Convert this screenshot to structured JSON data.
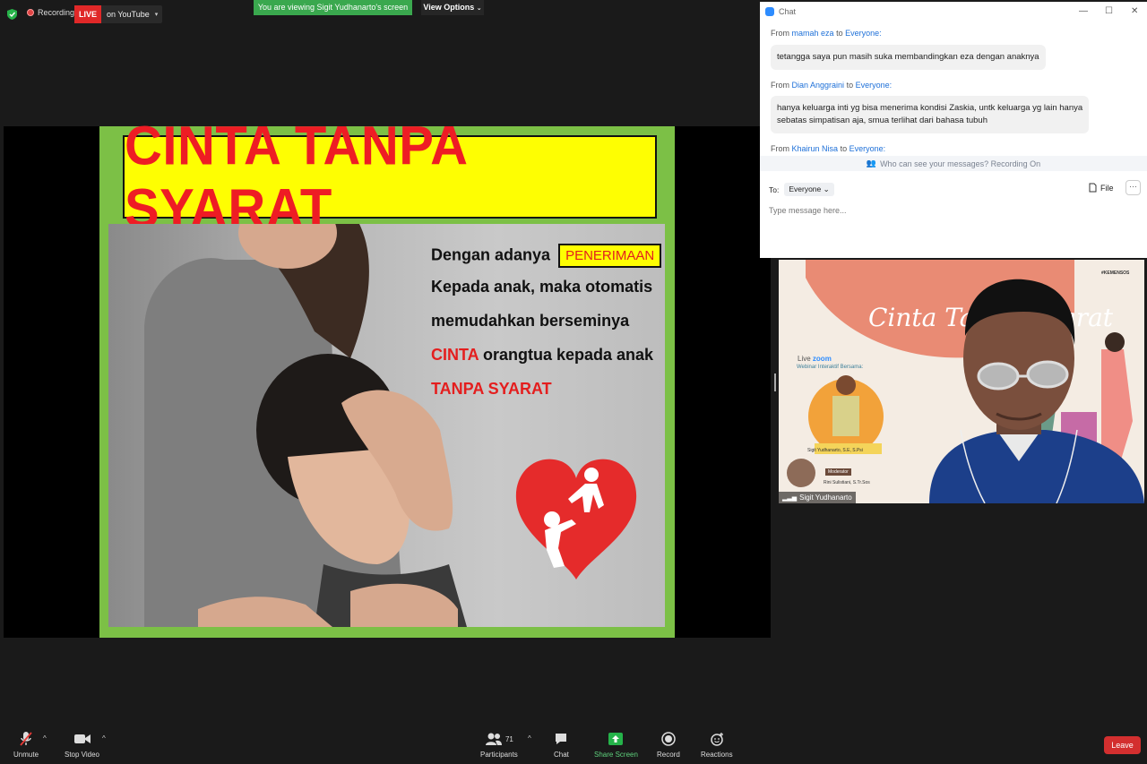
{
  "topbar": {
    "recording_label": "Recording",
    "live_badge": "LIVE",
    "live_destination": "on YouTube",
    "viewing_banner": "You are viewing Sigit Yudhanarto's screen",
    "view_options": "View Options"
  },
  "slide": {
    "title": "CINTA TANPA SYARAT",
    "line1_prefix": "Dengan adanya",
    "line1_box": "PENERIMAAN",
    "line2": "Kepada anak, maka otomatis",
    "line3": "memudahkan berseminya",
    "line4_red": "CINTA",
    "line4_rest": " orangtua kepada anak",
    "line5_red": "TANPA SYARAT",
    "colors": {
      "background": "#7cc046",
      "title_box": "#fefe02",
      "title_text": "#ee1c24",
      "accent_red": "#e41e1e"
    }
  },
  "chat": {
    "title": "Chat",
    "messages": [
      {
        "from_label": "From",
        "sender": "mamah eza",
        "to_label": "to",
        "recipient": "Everyone:",
        "text": "tetangga saya pun masih suka membandingkan eza dengan anaknya"
      },
      {
        "from_label": "From",
        "sender": "Dian Anggraini",
        "to_label": "to",
        "recipient": "Everyone:",
        "text_line1": "hanya keluarga inti yg bisa menerima kondisi Zaskia, untk keluarga yg lain hanya",
        "text_line2": "sebatas simpatisan aja, smua terlihat dari bahasa tubuh"
      },
      {
        "from_label": "From",
        "sender": "Khairun Nisa",
        "to_label": "to",
        "recipient": "Everyone:"
      }
    ],
    "who_can_see": "Who can see your messages? Recording On",
    "to_label": "To:",
    "to_value": "Everyone",
    "file_label": "File",
    "more_label": "···",
    "input_placeholder": "Type message here..."
  },
  "video": {
    "participant_name": "Sigit Yudhanarto",
    "poster_title": "Cinta Tanpa Syarat",
    "poster_live": "Live",
    "poster_zoom": "zoom",
    "poster_webinar": "Webinar Interaktif Bersama:",
    "poster_speaker": "Sigit Yudhanarto, S.E, S.Psi",
    "poster_moderator_label": "Moderator",
    "poster_moderator": "Rini Sulistiani, S.Tr.Sos",
    "poster_brand": "#KEMENSOS"
  },
  "toolbar": {
    "unmute": "Unmute",
    "stop_video": "Stop Video",
    "participants": "Participants",
    "participants_count": "71",
    "chat": "Chat",
    "share_screen": "Share Screen",
    "record": "Record",
    "reactions": "Reactions",
    "leave": "Leave"
  }
}
